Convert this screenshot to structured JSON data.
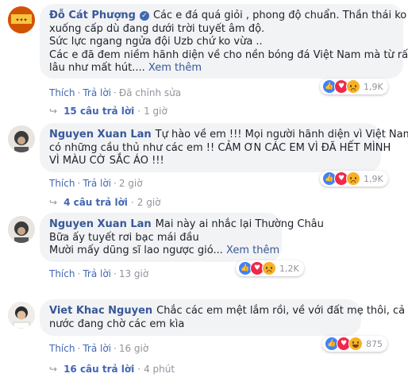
{
  "comments": [
    {
      "author": "Đỗ Cát Phượng",
      "verified": true,
      "lines": [
        "Các e đá quá giỏi , phong độ chuẩn. Thần thái ko",
        "xuống cấp dù đang dưới trời tuyết âm độ.",
        "Sức lực ngang ngửa đội Uzb chứ ko vừa ..",
        "Các e đã đem niềm hãnh diện về cho nền bóng đá Việt Nam mà từ rất",
        "lâu như mất hút...."
      ],
      "see_more": "Xem thêm",
      "reactions": [
        "like-icon",
        "love-icon",
        "sad-icon"
      ],
      "reaction_count": "1,9K",
      "actions": {
        "like": "Thích",
        "reply": "Trả lời",
        "edited": "Đã chỉnh sửa"
      },
      "reply_summary": {
        "label": "15 câu trả lời",
        "time": "1 giờ"
      }
    },
    {
      "author": "Nguyen Xuan Lan",
      "verified": false,
      "lines": [
        "Tự hào về em !!! Mọi người hãnh diện vì Việt Nam",
        "có những cầu thủ như các em !! CẢM ƠN CÁC EM VÌ ĐÃ HẾT MÌNH",
        "VÌ MÀU CỜ SẮC ÁO !!!"
      ],
      "see_more": "",
      "reactions": [
        "like-icon",
        "love-icon",
        "sad-icon"
      ],
      "reaction_count": "1,9K",
      "actions": {
        "like": "Thích",
        "reply": "Trả lời",
        "time": "2 giờ"
      },
      "reply_summary": {
        "label": "4 câu trả lời",
        "time": "2 giờ"
      }
    },
    {
      "author": "Nguyen Xuan Lan",
      "verified": false,
      "lines": [
        "Mai này ai nhắc lại Thường Châu",
        "Bữa ấy tuyết rơi bạc mái đầu",
        "Mười mấy dũng sĩ lao ngược gió..."
      ],
      "see_more": "Xem thêm",
      "reactions": [
        "like-icon",
        "love-icon",
        "sad-icon"
      ],
      "reaction_count": "1,2K",
      "actions": {
        "like": "Thích",
        "reply": "Trả lời",
        "time": "13 giờ"
      },
      "reply_summary": {
        "label": "",
        "time": ""
      }
    },
    {
      "author": "Viet Khac Nguyen",
      "verified": false,
      "lines": [
        "Chắc các em mệt lắm rồi, về với đất mẹ thôi, cả",
        "nước đang chờ các em kìa"
      ],
      "see_more": "",
      "reactions": [
        "like-icon",
        "love-icon",
        "haha-icon"
      ],
      "reaction_count": "875",
      "actions": {
        "like": "Thích",
        "reply": "Trả lời",
        "time": "16 giờ"
      },
      "reply_summary": {
        "label": "16 câu trả lời",
        "time": "4 phút"
      }
    }
  ],
  "colors": {
    "link": "#385898",
    "bubble": "#f2f3f5",
    "meta": "#90949c",
    "like": "#4080ff",
    "love": "#f0284a",
    "sad": "#f7b125"
  }
}
